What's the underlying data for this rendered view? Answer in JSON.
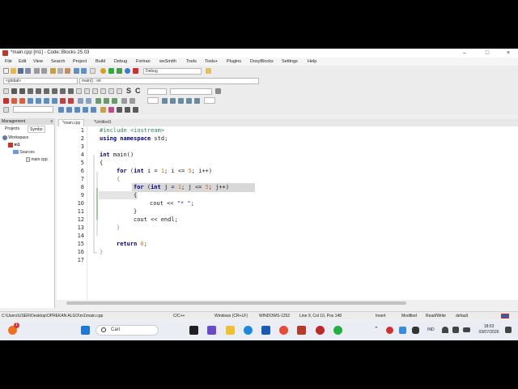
{
  "window": {
    "title": "*main.cpp [m1] - Code::Blocks 25.03",
    "minimize": "–",
    "maximize": "□",
    "close": "×"
  },
  "menu": [
    "File",
    "Edit",
    "View",
    "Search",
    "Project",
    "Build",
    "Debug",
    "Fortran",
    "wxSmith",
    "Tools",
    "Tools+",
    "Plugins",
    "DoxyBlocks",
    "Settings",
    "Help"
  ],
  "toolbar": {
    "build_target": "Debug",
    "scope": "<global>",
    "function": "main() : int",
    "search_glyphs": [
      "S",
      "C"
    ]
  },
  "management": {
    "title": "Management",
    "close": "x",
    "tabs": [
      "Projects",
      "Symbo"
    ],
    "tree": {
      "workspace": "Workspace",
      "project": "m1",
      "folder": "Sources",
      "file": "main.cpp"
    }
  },
  "editor": {
    "tabs": [
      "*main.cpp",
      "*Untitled1"
    ],
    "lines": [
      "1",
      "2",
      "3",
      "4",
      "5",
      "6",
      "7",
      "8",
      "9",
      "10",
      "11",
      "12",
      "13",
      "14",
      "15",
      "16",
      "17"
    ],
    "code": {
      "l1_pp": "#include <iostream>",
      "l2_kw": "using namespace",
      "l2_rest": " std;",
      "l4_kw": "int",
      "l4_rest": " main()",
      "l5": "{",
      "l6_kw": "for",
      "l6_a": " (",
      "l6_kw2": "int",
      "l6_b": " i = ",
      "l6_n1": "1",
      "l6_c": "; i <= ",
      "l6_n2": "5",
      "l6_d": "; i++)",
      "l7": "{",
      "l8_kw": "for",
      "l8_a": " (",
      "l8_kw2": "int",
      "l8_b": " j = ",
      "l8_n1": "1",
      "l8_c": "; j <= ",
      "l8_n2": "5",
      "l8_d": "; j++)",
      "l9": "{",
      "l10_a": "cout << ",
      "l10_str": "\"* \"",
      "l10_b": ";",
      "l11": "}",
      "l12": "cout << endl;",
      "l13": "}",
      "l15_kw": "return",
      "l15_sp": " ",
      "l15_n": "0",
      "l15_b": ";",
      "l16": "}"
    }
  },
  "status": {
    "path": "C:\\Users\\USER\\Desktop\\OPREKAN ALGO\\m1\\main.cpp",
    "lang": "C/C++",
    "eol": "Windows (CR+LF)",
    "encoding": "WINDOWS-1252",
    "position": "Line 9, Col 10, Pos 148",
    "mode": "Insert",
    "modified": "Modified",
    "rw": "Read/Write",
    "profile": "default"
  },
  "taskbar": {
    "search_placeholder": "Cari",
    "notification_count": "1",
    "lang": "IND",
    "time": "18:03",
    "date": "03/07/2026"
  },
  "colors": {
    "keyword": "#00008b",
    "preprocessor": "#2e8b57",
    "string": "#1a1aff",
    "number": "#e07000",
    "selection": "#d8d8d8"
  }
}
